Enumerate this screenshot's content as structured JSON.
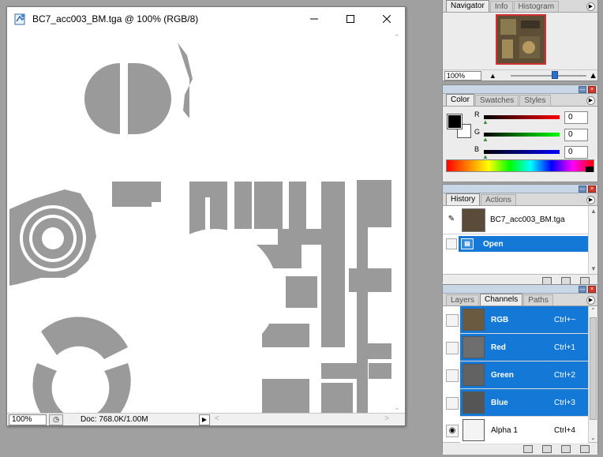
{
  "document": {
    "title": "BC7_acc003_BM.tga @ 100% (RGB/8)",
    "zoom": "100%",
    "doc_info": "Doc: 768.0K/1.00M"
  },
  "navigator": {
    "tabs": [
      "Navigator",
      "Info",
      "Histogram"
    ],
    "zoom": "100%"
  },
  "color": {
    "tabs": [
      "Color",
      "Swatches",
      "Styles"
    ],
    "channels": [
      {
        "label": "R",
        "value": "0"
      },
      {
        "label": "G",
        "value": "0"
      },
      {
        "label": "B",
        "value": "0"
      }
    ],
    "foreground": "#000000",
    "background": "#ffffff"
  },
  "history": {
    "tabs": [
      "History",
      "Actions"
    ],
    "snapshot": "BC7_acc003_BM.tga",
    "steps": [
      "Open"
    ]
  },
  "channels": {
    "tabs": [
      "Layers",
      "Channels",
      "Paths"
    ],
    "rows": [
      {
        "name": "RGB",
        "shortcut": "Ctrl+~"
      },
      {
        "name": "Red",
        "shortcut": "Ctrl+1"
      },
      {
        "name": "Green",
        "shortcut": "Ctrl+2"
      },
      {
        "name": "Blue",
        "shortcut": "Ctrl+3"
      },
      {
        "name": "Alpha 1",
        "shortcut": "Ctrl+4"
      }
    ]
  },
  "colors": {
    "selection": "#1478d7",
    "canvas_gray": "#999999",
    "app_background": "#a0a0a0"
  }
}
